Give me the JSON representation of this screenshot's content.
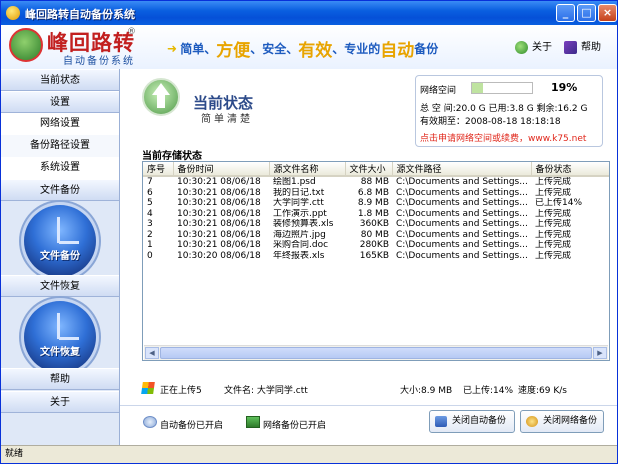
{
  "window": {
    "title": "峰回路转自动备份系统"
  },
  "header": {
    "logo_title": "峰回路转",
    "logo_reg": "®",
    "logo_sub": "自动备份系统",
    "slogan": [
      {
        "text": "简单、",
        "size": "small"
      },
      {
        "text": "方便",
        "size": "big"
      },
      {
        "text": "、安全、",
        "size": "small"
      },
      {
        "text": "有效",
        "size": "big"
      },
      {
        "text": "、专业的",
        "size": "small"
      },
      {
        "text": "自动",
        "size": "big"
      },
      {
        "text": "备份",
        "size": "small"
      }
    ],
    "about_label": "关于",
    "help_label": "帮助"
  },
  "sidebar": {
    "section_status": "当前状态",
    "section_settings": "设置",
    "item_network": "网络设置",
    "item_path": "备份路径设置",
    "item_system": "系统设置",
    "section_backup": "文件备份",
    "circle_backup": "文件备份",
    "section_restore": "文件恢复",
    "circle_restore": "文件恢复",
    "section_help": "帮助",
    "section_about": "关于"
  },
  "main": {
    "page_title": "当前状态",
    "page_subtitle": "简单清楚",
    "quota": {
      "label": "网络空间",
      "percent_text": "19%",
      "fill_fraction": 0.19,
      "line1": "总 空 间:20.0 G  已用:3.8 G  剩余:16.2 G",
      "line2": "有效期至：2008-08-18 18:18:18",
      "link": "点击申请网络空间或续费，www.k75.net"
    },
    "list_title": "当前存储状态",
    "columns": [
      "序号",
      "备份时间",
      "源文件名称",
      "文件大小",
      "源文件路径",
      "备份状态"
    ],
    "rows": [
      [
        "7",
        "10:30:21 08/06/18",
        "绘图1.psd",
        "88 MB",
        "C:\\Documents and Settings...",
        "上传完成"
      ],
      [
        "6",
        "10:30:21 08/06/18",
        "我的日记.txt",
        "6.8 MB",
        "C:\\Documents and Settings...",
        "上传完成"
      ],
      [
        "5",
        "10:30:21 08/06/18",
        "大学同学.ctt",
        "8.9 MB",
        "C:\\Documents and Settings...",
        "已上传14%"
      ],
      [
        "4",
        "10:30:21 08/06/18",
        "工作演示.ppt",
        "1.8 MB",
        "C:\\Documents and Settings...",
        "上传完成"
      ],
      [
        "3",
        "10:30:21 08/06/18",
        "装修预算表.xls",
        "360KB",
        "C:\\Documents and Settings...",
        "上传完成"
      ],
      [
        "2",
        "10:30:21 08/06/18",
        "海边照片.jpg",
        "80 MB",
        "C:\\Documents and Settings...",
        "上传完成"
      ],
      [
        "1",
        "10:30:21 08/06/18",
        "采购合同.doc",
        "280KB",
        "C:\\Documents and Settings...",
        "上传完成"
      ],
      [
        "0",
        "10:30:20 08/06/18",
        "年终报表.xls",
        "165KB",
        "C:\\Documents and Settings...",
        "上传完成"
      ]
    ],
    "status": {
      "uploading": "正在上传5",
      "file_name": "文件名: 大学同学.ctt",
      "size": "大小:8.9 MB",
      "uploaded": "已上传:14%",
      "speed": "速度:69 K/s"
    },
    "auto_backup_status": "自动备份已开启",
    "net_backup_status": "网络备份已开启",
    "btn_close_auto": "关闭自动备份",
    "btn_close_net": "关闭网络备份"
  },
  "statusbar": {
    "text": "就绪"
  },
  "colors": {
    "titlebar": "#0a5fe0",
    "brand_red": "#c21f1f",
    "slogan_gold": "#e8a400",
    "slogan_blue": "#1d5bbf",
    "link_red": "#e0261a"
  }
}
